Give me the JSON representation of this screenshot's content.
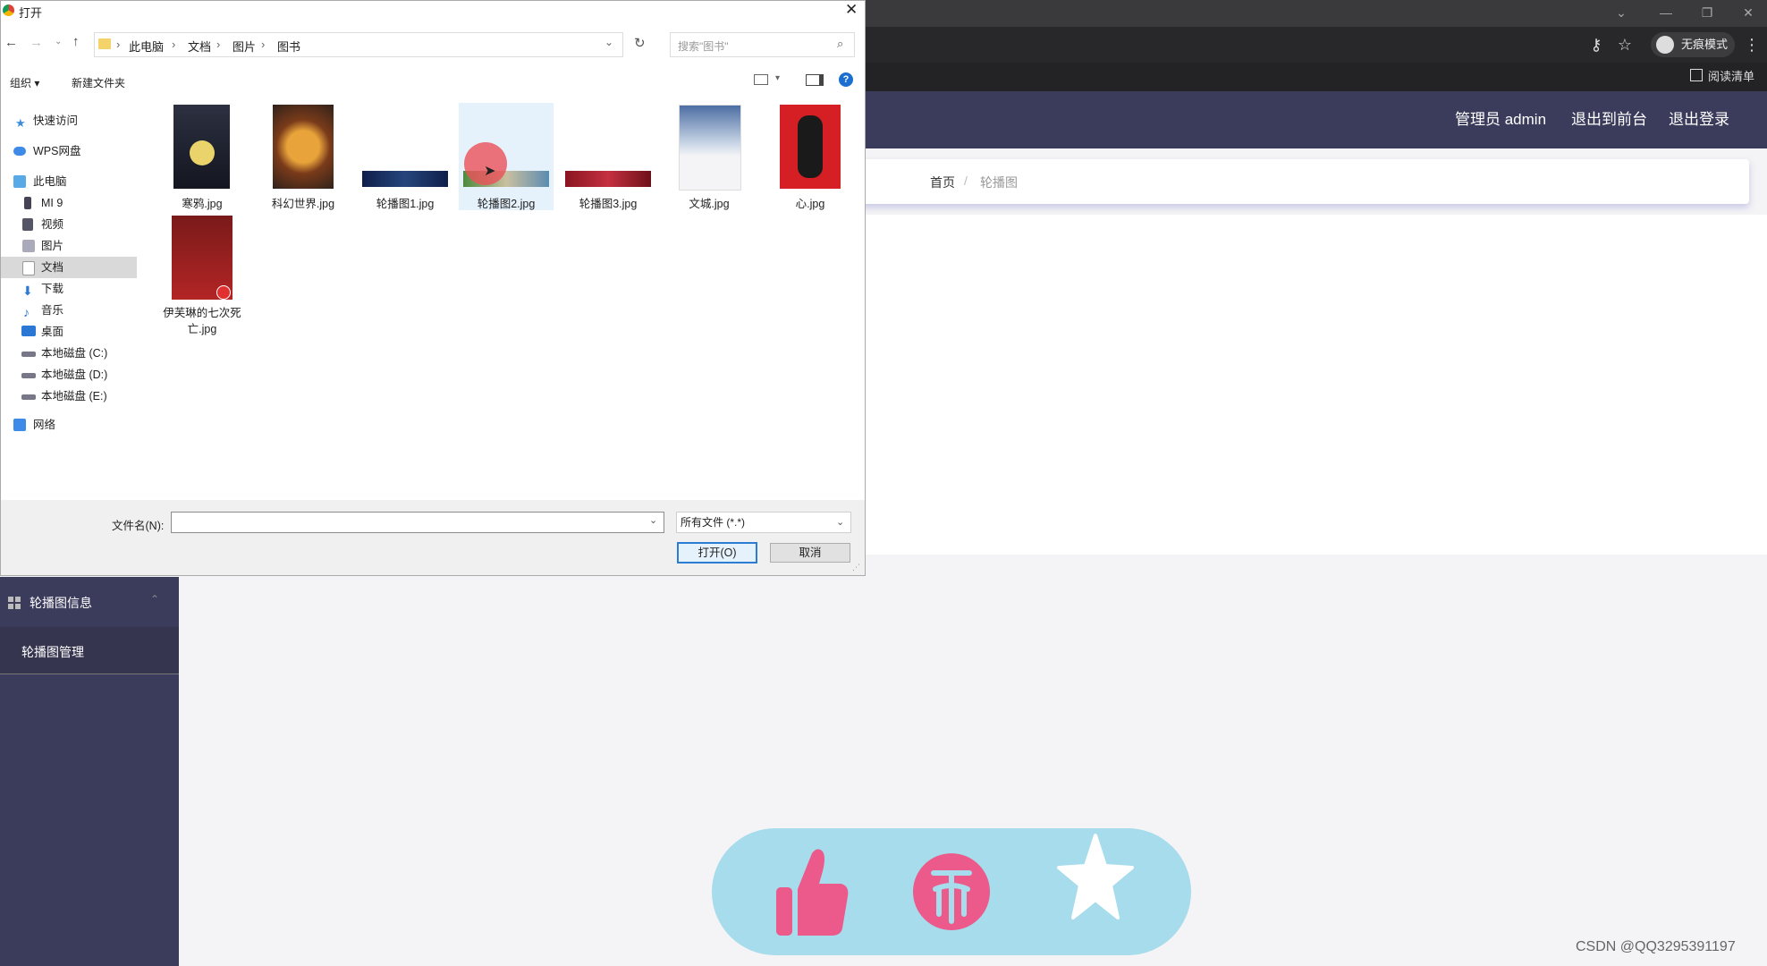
{
  "browser": {
    "incognito_label": "无痕模式",
    "reading_list": "阅读清单"
  },
  "app": {
    "header": {
      "admin": "管理员 admin",
      "exit_front": "退出到前台",
      "logout": "退出登录"
    },
    "breadcrumb": {
      "home": "首页",
      "separator": "/",
      "current": "轮播图"
    },
    "sidebar": {
      "group": "轮播图信息",
      "item": "轮播图管理"
    },
    "colors": {
      "header_bg": "#3b3b5c",
      "action_bar_bg": "#a6dceb",
      "icon_pink": "#ec5a8c"
    },
    "action_icons": [
      "thumbs-up-icon",
      "coin-icon",
      "star-icon"
    ]
  },
  "dialog": {
    "title": "打开",
    "address": [
      "此电脑",
      "文档",
      "图片",
      "图书"
    ],
    "search_placeholder": "搜索\"图书\"",
    "toolbar": {
      "organize": "组织 ▾",
      "new_folder": "新建文件夹",
      "help": "?"
    },
    "nav": [
      {
        "label": "快速访问",
        "icon": "star-icon"
      },
      {
        "label": "WPS网盘",
        "icon": "cloud-icon"
      },
      {
        "label": "此电脑",
        "icon": "computer-icon"
      },
      {
        "label": "MI 9",
        "icon": "phone-icon"
      },
      {
        "label": "视频",
        "icon": "video-icon"
      },
      {
        "label": "图片",
        "icon": "picture-icon"
      },
      {
        "label": "文档",
        "icon": "document-icon"
      },
      {
        "label": "下载",
        "icon": "download-icon"
      },
      {
        "label": "音乐",
        "icon": "music-icon"
      },
      {
        "label": "桌面",
        "icon": "desktop-icon"
      },
      {
        "label": "本地磁盘 (C:)",
        "icon": "drive-icon"
      },
      {
        "label": "本地磁盘 (D:)",
        "icon": "drive-icon"
      },
      {
        "label": "本地磁盘 (E:)",
        "icon": "drive-icon"
      },
      {
        "label": "网络",
        "icon": "network-icon"
      }
    ],
    "files": [
      {
        "name": "寒鸦.jpg"
      },
      {
        "name": "科幻世界.jpg"
      },
      {
        "name": "轮播图1.jpg"
      },
      {
        "name": "轮播图2.jpg"
      },
      {
        "name": "轮播图3.jpg"
      },
      {
        "name": "文城.jpg"
      },
      {
        "name": "心.jpg"
      },
      {
        "name": "伊芙琳的七次死亡.jpg"
      }
    ],
    "filename_label": "文件名(N):",
    "filename_value": "",
    "filetype": "所有文件 (*.*)",
    "open_button": "打开(O)",
    "cancel_button": "取消"
  },
  "watermark": "CSDN @QQ3295391197"
}
